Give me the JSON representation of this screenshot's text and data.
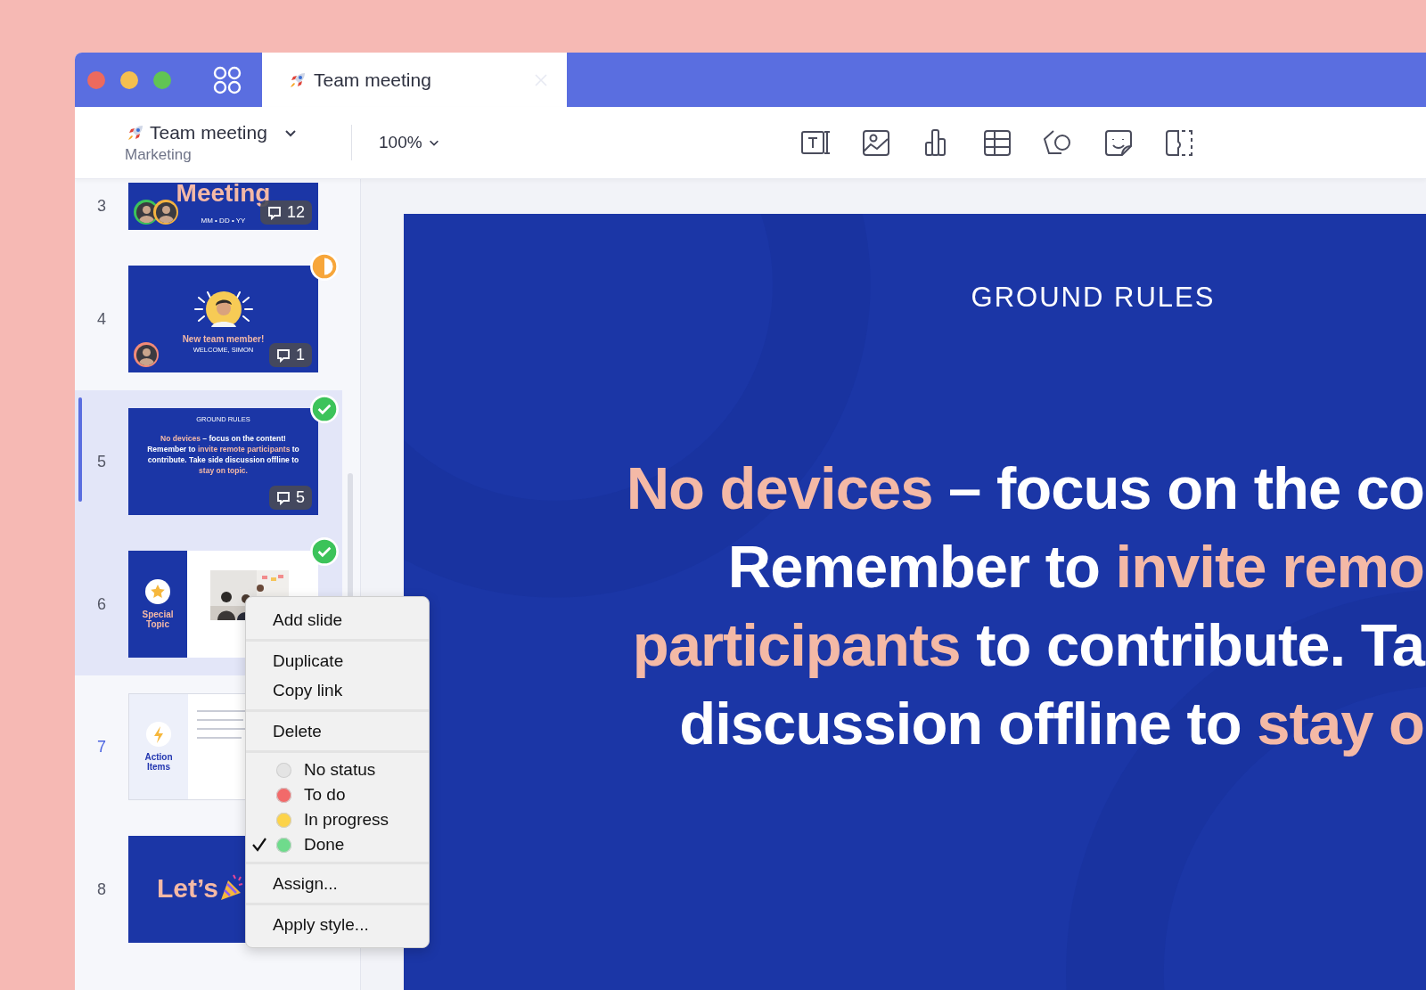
{
  "tab": {
    "title": "Team meeting"
  },
  "toolbar": {
    "document": "Team meeting",
    "folder": "Marketing",
    "zoom": "100%"
  },
  "slides": [
    {
      "number": "3",
      "kind": "title",
      "title": "Meeting",
      "date": "MM • DD • YY",
      "avatars": [
        {
          "color": "#3cc35a"
        },
        {
          "color": "#f5b340"
        }
      ],
      "comments": "12",
      "done": false,
      "in_progress": false,
      "selected": false,
      "current": false,
      "hovered": false
    },
    {
      "number": "4",
      "kind": "welcome",
      "title": "New team member!",
      "subtitle": "WELCOME, SIMON",
      "avatars": [
        {
          "color": "#f28b78"
        }
      ],
      "comments": "1",
      "done": false,
      "in_progress": true,
      "selected": false,
      "current": false,
      "hovered": false
    },
    {
      "number": "5",
      "kind": "text",
      "heading": "GROUND RULES",
      "text": [
        {
          "text": "No devices",
          "highlight": true
        },
        {
          "text": " – focus on the content! Remember to ",
          "highlight": false
        },
        {
          "text": "invite remote participants",
          "highlight": true
        },
        {
          "text": " to contribute. Take side discussion offline to ",
          "highlight": false
        },
        {
          "text": "stay on topic.",
          "highlight": true
        }
      ],
      "comments": "5",
      "done": true,
      "in_progress": false,
      "selected": true,
      "current": true,
      "hovered": false
    },
    {
      "number": "6",
      "kind": "split",
      "title": "Special Topic",
      "done": true,
      "in_progress": false,
      "selected": true,
      "current": false,
      "hovered": false
    },
    {
      "number": "7",
      "kind": "list",
      "title": "Action Items",
      "done": false,
      "in_progress": false,
      "selected": false,
      "current": false,
      "hovered": true
    },
    {
      "number": "8",
      "kind": "closing",
      "title": "Let’s",
      "done": false,
      "in_progress": false,
      "selected": false,
      "current": false,
      "hovered": false
    }
  ],
  "menu": [
    {
      "items": [
        {
          "kind": "action",
          "label": "Add slide"
        }
      ]
    },
    {
      "items": [
        {
          "kind": "action",
          "label": "Duplicate"
        },
        {
          "kind": "action",
          "label": "Copy link"
        }
      ]
    },
    {
      "items": [
        {
          "kind": "action",
          "label": "Delete"
        }
      ]
    },
    {
      "items": [
        {
          "kind": "status",
          "label": "No status",
          "color": "#e4e4e4",
          "checked": false
        },
        {
          "kind": "status",
          "label": "To do",
          "color": "#f26a6a",
          "checked": false
        },
        {
          "kind": "status",
          "label": "In progress",
          "color": "#fcd34a",
          "checked": false
        },
        {
          "kind": "status",
          "label": "Done",
          "color": "#6fdb8c",
          "checked": true
        }
      ]
    },
    {
      "items": [
        {
          "kind": "action",
          "label": "Assign..."
        }
      ]
    },
    {
      "items": [
        {
          "kind": "action",
          "label": "Apply style..."
        }
      ]
    }
  ],
  "slide": {
    "heading": "GROUND RULES",
    "lines": [
      [
        {
          "text": "No devices",
          "highlight": true
        },
        {
          "text": " – focus on the co",
          "highlight": false
        }
      ],
      [
        {
          "text": "Remember to ",
          "highlight": false
        },
        {
          "text": "invite remo",
          "highlight": true
        }
      ],
      [
        {
          "text": "participants",
          "highlight": true
        },
        {
          "text": " to contribute. Ta",
          "highlight": false
        }
      ],
      [
        {
          "text": "discussion offline to ",
          "highlight": false
        },
        {
          "text": "stay o",
          "highlight": true
        }
      ]
    ]
  }
}
